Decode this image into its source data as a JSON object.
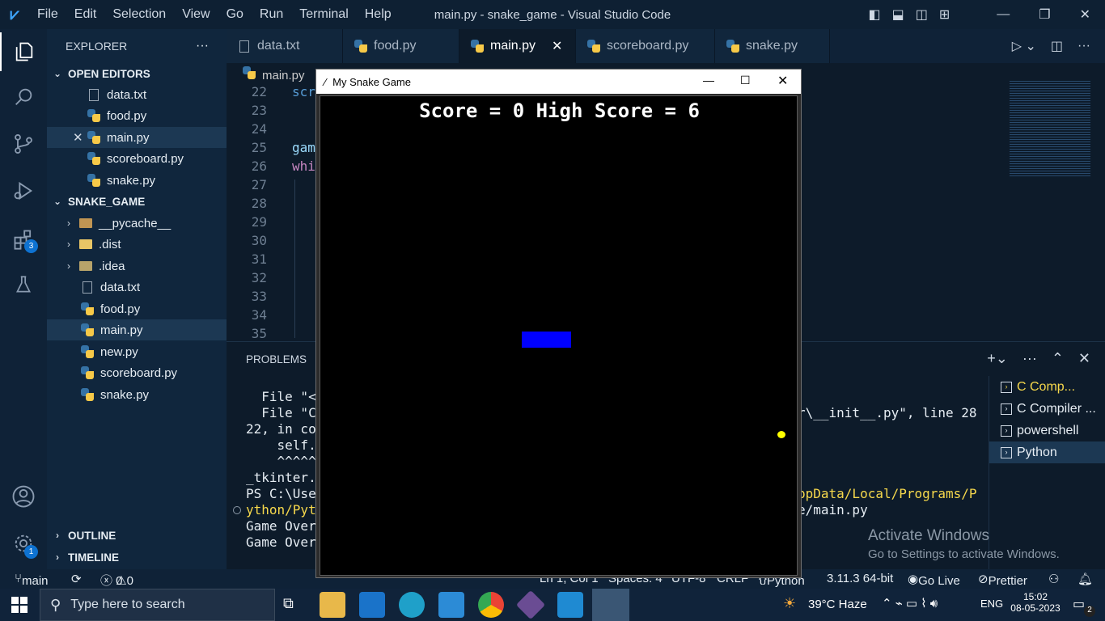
{
  "titlebar": {
    "menu": [
      "File",
      "Edit",
      "Selection",
      "View",
      "Go",
      "Run",
      "Terminal",
      "Help"
    ],
    "window_title": "main.py - snake_game - Visual Studio Code"
  },
  "activity": {
    "extensions_badge": "3",
    "settings_badge": "1"
  },
  "explorer": {
    "title": "EXPLORER",
    "open_editors_label": "OPEN EDITORS",
    "open_editors": [
      "data.txt",
      "food.py",
      "main.py",
      "scoreboard.py",
      "snake.py"
    ],
    "project_label": "SNAKE_GAME",
    "folders": [
      "__pycache__",
      ".dist",
      ".idea"
    ],
    "files": [
      "data.txt",
      "food.py",
      "main.py",
      "new.py",
      "scoreboard.py",
      "snake.py"
    ],
    "outline_label": "OUTLINE",
    "timeline_label": "TIMELINE"
  },
  "tabs": [
    "data.txt",
    "food.py",
    "main.py",
    "scoreboard.py",
    "snake.py"
  ],
  "editor": {
    "breadcrumb": "main.py",
    "line_numbers": [
      "22",
      "23",
      "24",
      "25",
      "26",
      "27",
      "28",
      "29",
      "30",
      "31",
      "32",
      "33",
      "34",
      "35"
    ],
    "code_22": "scr",
    "code_25": "gam",
    "code_26": "whi"
  },
  "panel": {
    "tab_problems": "PROBLEMS",
    "lines": [
      "  File \"<s",
      "  File \"C:",
      "22, in coc",
      "    self.t",
      "    ^^^^^^",
      "_tkinter.T",
      "PS C:\\User",
      "ython/Pyth",
      "Game Over",
      "Game Over"
    ],
    "right_1": "r\\__init__.py\", line 28",
    "right_2": "ppData/Local/Programs/P",
    "right_3": "e/main.py",
    "terminals": [
      "C Comp...",
      "C Compiler ...",
      "powershell",
      "Python"
    ]
  },
  "watermark": {
    "line1": "Activate Windows",
    "line2": "Go to Settings to activate Windows."
  },
  "status": {
    "branch": "main",
    "errors": "0",
    "warnings": "0",
    "position": "Ln 1, Col 1",
    "spaces": "Spaces: 4",
    "encoding": "UTF-8",
    "eol": "CRLF",
    "language": "Python",
    "version": "3.11.3 64-bit",
    "golive": "Go Live",
    "prettier": "Prettier"
  },
  "taskbar": {
    "search_placeholder": "Type here to search",
    "weather": "39°C  Haze",
    "lang": "ENG",
    "time": "15:02",
    "date": "08-05-2023",
    "notif_count": "2"
  },
  "snake_window": {
    "title": "My Snake Game",
    "score_text": "Score = 0 High Score = 6"
  },
  "colors": {
    "snake": "#0000ff",
    "food": "#ffff00",
    "accent": "#0e72d1"
  }
}
